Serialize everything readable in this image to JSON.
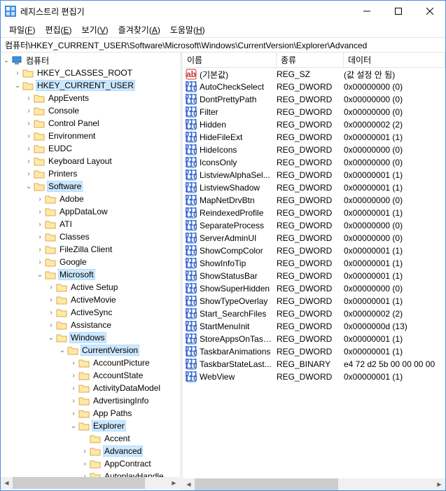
{
  "window": {
    "title": "레지스트리 편집기"
  },
  "menu": {
    "file": "파일(F)",
    "edit": "편집(E)",
    "view": "보기(V)",
    "fav": "즐겨찾기(A)",
    "help": "도움말(H)",
    "file_u": "F",
    "edit_u": "E",
    "view_u": "V",
    "fav_u": "A",
    "help_u": "H",
    "file_t": "파일",
    "edit_t": "편집",
    "view_t": "보기",
    "fav_t": "즐겨찾기",
    "help_t": "도움말"
  },
  "address": "컴퓨터\\HKEY_CURRENT_USER\\Software\\Microsoft\\Windows\\CurrentVersion\\Explorer\\Advanced",
  "tree": {
    "root": "컴퓨터",
    "hkcr": "HKEY_CLASSES_ROOT",
    "hkcu": "HKEY_CURRENT_USER",
    "hkcu_children": [
      "AppEvents",
      "Console",
      "Control Panel",
      "Environment",
      "EUDC",
      "Keyboard Layout",
      "Printers"
    ],
    "software": "Software",
    "software_children": [
      "Adobe",
      "AppDataLow",
      "ATI",
      "Classes",
      "FileZilla Client",
      "Google"
    ],
    "microsoft": "Microsoft",
    "microsoft_children": [
      "Active Setup",
      "ActiveMovie",
      "ActiveSync",
      "Assistance"
    ],
    "windows": "Windows",
    "currentversion": "CurrentVersion",
    "cv_children": [
      "AccountPicture",
      "AccountState",
      "ActivityDataModel",
      "AdvertisingInfo",
      "App Paths"
    ],
    "explorer": "Explorer",
    "ex_children_before": [
      "Accent"
    ],
    "advanced": "Advanced",
    "ex_children_after": [
      "AppContract",
      "AutoplayHandle"
    ]
  },
  "list": {
    "headers": {
      "name": "이름",
      "type": "종류",
      "data": "데이터"
    },
    "rows": [
      {
        "icon": "str",
        "name": "(기본값)",
        "type": "REG_SZ",
        "data": "(값 설정 안 됨)"
      },
      {
        "icon": "bin",
        "name": "AutoCheckSelect",
        "type": "REG_DWORD",
        "data": "0x00000000 (0)"
      },
      {
        "icon": "bin",
        "name": "DontPrettyPath",
        "type": "REG_DWORD",
        "data": "0x00000000 (0)"
      },
      {
        "icon": "bin",
        "name": "Filter",
        "type": "REG_DWORD",
        "data": "0x00000000 (0)"
      },
      {
        "icon": "bin",
        "name": "Hidden",
        "type": "REG_DWORD",
        "data": "0x00000002 (2)"
      },
      {
        "icon": "bin",
        "name": "HideFileExt",
        "type": "REG_DWORD",
        "data": "0x00000001 (1)"
      },
      {
        "icon": "bin",
        "name": "HideIcons",
        "type": "REG_DWORD",
        "data": "0x00000000 (0)"
      },
      {
        "icon": "bin",
        "name": "IconsOnly",
        "type": "REG_DWORD",
        "data": "0x00000000 (0)"
      },
      {
        "icon": "bin",
        "name": "ListviewAlphaSel...",
        "type": "REG_DWORD",
        "data": "0x00000001 (1)"
      },
      {
        "icon": "bin",
        "name": "ListviewShadow",
        "type": "REG_DWORD",
        "data": "0x00000001 (1)"
      },
      {
        "icon": "bin",
        "name": "MapNetDrvBtn",
        "type": "REG_DWORD",
        "data": "0x00000000 (0)"
      },
      {
        "icon": "bin",
        "name": "ReindexedProfile",
        "type": "REG_DWORD",
        "data": "0x00000001 (1)"
      },
      {
        "icon": "bin",
        "name": "SeparateProcess",
        "type": "REG_DWORD",
        "data": "0x00000000 (0)"
      },
      {
        "icon": "bin",
        "name": "ServerAdminUI",
        "type": "REG_DWORD",
        "data": "0x00000000 (0)"
      },
      {
        "icon": "bin",
        "name": "ShowCompColor",
        "type": "REG_DWORD",
        "data": "0x00000001 (1)"
      },
      {
        "icon": "bin",
        "name": "ShowInfoTip",
        "type": "REG_DWORD",
        "data": "0x00000001 (1)"
      },
      {
        "icon": "bin",
        "name": "ShowStatusBar",
        "type": "REG_DWORD",
        "data": "0x00000001 (1)"
      },
      {
        "icon": "bin",
        "name": "ShowSuperHidden",
        "type": "REG_DWORD",
        "data": "0x00000000 (0)"
      },
      {
        "icon": "bin",
        "name": "ShowTypeOverlay",
        "type": "REG_DWORD",
        "data": "0x00000001 (1)"
      },
      {
        "icon": "bin",
        "name": "Start_SearchFiles",
        "type": "REG_DWORD",
        "data": "0x00000002 (2)"
      },
      {
        "icon": "bin",
        "name": "StartMenuInit",
        "type": "REG_DWORD",
        "data": "0x0000000d (13)"
      },
      {
        "icon": "bin",
        "name": "StoreAppsOnTask...",
        "type": "REG_DWORD",
        "data": "0x00000001 (1)"
      },
      {
        "icon": "bin",
        "name": "TaskbarAnimations",
        "type": "REG_DWORD",
        "data": "0x00000001 (1)"
      },
      {
        "icon": "bin",
        "name": "TaskbarStateLast...",
        "type": "REG_BINARY",
        "data": "e4 72 d2 5b 00 00 00 00"
      },
      {
        "icon": "bin",
        "name": "WebView",
        "type": "REG_DWORD",
        "data": "0x00000001 (1)"
      }
    ]
  }
}
